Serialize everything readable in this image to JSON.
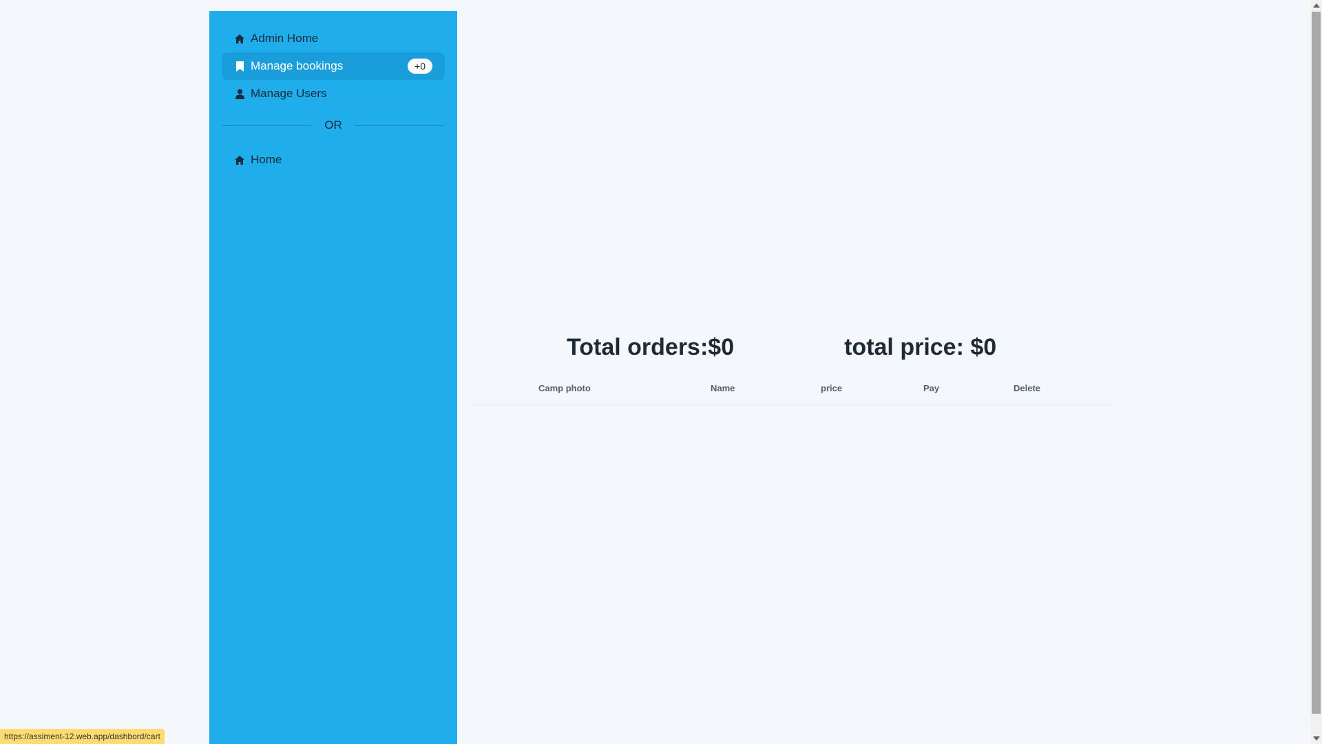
{
  "sidebar": {
    "items": [
      {
        "label": "Admin Home",
        "icon": "home-icon"
      },
      {
        "label": "Manage bookings",
        "icon": "bookmark-icon",
        "badge": "+0",
        "active": true
      },
      {
        "label": "Manage Users",
        "icon": "user-icon"
      }
    ],
    "divider_label": "OR",
    "secondary_items": [
      {
        "label": "Home",
        "icon": "home-icon"
      }
    ]
  },
  "main": {
    "total_orders": "Total orders:$0",
    "total_price": "total price: $0",
    "table": {
      "columns": [
        "Camp photo",
        "Name",
        "price",
        "Pay",
        "Delete"
      ],
      "rows": []
    }
  },
  "statusbar": {
    "url": "https://assiment-12.web.app/dashbord/cart"
  },
  "colors": {
    "sidebar_bg": "#1fadeb",
    "active_item_bg": "#1a9edb",
    "page_bg": "#f5f8fb"
  }
}
